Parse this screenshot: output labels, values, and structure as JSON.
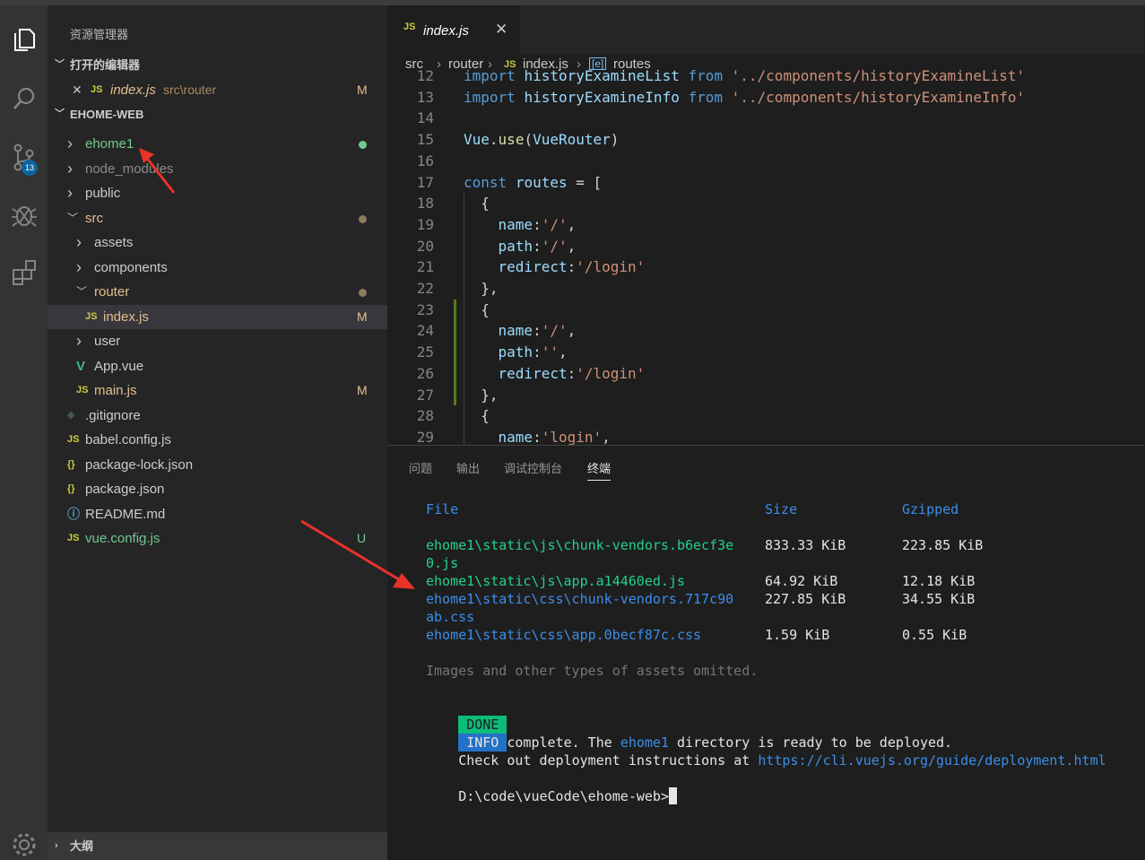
{
  "activity": {
    "icons": [
      "explorer-icon",
      "search-icon",
      "source-control-icon",
      "debug-icon",
      "extensions-icon",
      "settings-gear-icon"
    ],
    "scm_badge": "13"
  },
  "sidebar": {
    "title": "资源管理器",
    "open_editors_header": "打开的编辑器",
    "open_editor": {
      "name": "index.js",
      "path": "src\\router",
      "status": "M",
      "icon": "JS"
    },
    "project_header": "EHOME-WEB",
    "outline_header": "大纲",
    "tree": [
      {
        "label": "ehome1",
        "kind": "folder",
        "dot": "#73c991"
      },
      {
        "label": "node_modules",
        "kind": "folder"
      },
      {
        "label": "public",
        "kind": "folder"
      },
      {
        "label": "src",
        "kind": "folder-open",
        "dot": "#8b7b5e"
      },
      {
        "label": "assets",
        "kind": "folder"
      },
      {
        "label": "components",
        "kind": "folder"
      },
      {
        "label": "router",
        "kind": "folder-open",
        "dot": "#8b7b5e"
      },
      {
        "label": "index.js",
        "kind": "js",
        "status": "M"
      },
      {
        "label": "user",
        "kind": "folder"
      },
      {
        "label": "App.vue",
        "kind": "vue"
      },
      {
        "label": "main.js",
        "kind": "js",
        "status": "M"
      },
      {
        "label": ".gitignore",
        "kind": "git"
      },
      {
        "label": "babel.config.js",
        "kind": "js"
      },
      {
        "label": "package-lock.json",
        "kind": "json"
      },
      {
        "label": "package.json",
        "kind": "json"
      },
      {
        "label": "README.md",
        "kind": "info"
      },
      {
        "label": "vue.config.js",
        "kind": "js",
        "status": "U"
      }
    ],
    "icon_glyphs": {
      "js": "JS",
      "json": "{}",
      "vue": "V",
      "info": "ⓘ",
      "git": "◆"
    }
  },
  "editor": {
    "tab_label": "index.js",
    "tab_icon": "JS",
    "close_glyph": "✕",
    "breadcrumb": [
      "src",
      "router",
      "index.js",
      "routes"
    ],
    "breadcrumb_sep": "›",
    "lines": [
      {
        "n": "12",
        "text": "import historyExamineList from '../components/historyExamineList'"
      },
      {
        "n": "13",
        "text": "import historyExamineInfo from '../components/historyExamineInfo'"
      },
      {
        "n": "14",
        "text": ""
      },
      {
        "n": "15",
        "text": "Vue.use(VueRouter)"
      },
      {
        "n": "16",
        "text": ""
      },
      {
        "n": "17",
        "text": "const routes = ["
      },
      {
        "n": "18",
        "text": "  {"
      },
      {
        "n": "19",
        "text": "    name:'/',"
      },
      {
        "n": "20",
        "text": "    path:'/',"
      },
      {
        "n": "21",
        "text": "    redirect:'/login'"
      },
      {
        "n": "22",
        "text": "  },"
      },
      {
        "n": "23",
        "text": "  {"
      },
      {
        "n": "24",
        "text": "    name:'/',"
      },
      {
        "n": "25",
        "text": "    path:'',"
      },
      {
        "n": "26",
        "text": "    redirect:'/login'"
      },
      {
        "n": "27",
        "text": "  },"
      },
      {
        "n": "28",
        "text": "  {"
      },
      {
        "n": "29",
        "text": "    name:'login',"
      }
    ]
  },
  "panel": {
    "tabs": [
      "问题",
      "输出",
      "调试控制台",
      "终端"
    ],
    "active_tab": "终端",
    "headers": {
      "file": "File",
      "size": "Size",
      "gzipped": "Gzipped"
    },
    "rows": [
      {
        "file1": "ehome1\\static\\js\\chunk-vendors.b6ecf3e",
        "file2": "0.js",
        "size": "833.33 KiB",
        "gz": "223.85 KiB",
        "color": "green"
      },
      {
        "file1": "ehome1\\static\\js\\app.a14460ed.js",
        "file2": "",
        "size": "64.92 KiB",
        "gz": "12.18 KiB",
        "color": "green"
      },
      {
        "file1": "ehome1\\static\\css\\chunk-vendors.717c90",
        "file2": "ab.css",
        "size": "227.85 KiB",
        "gz": "34.55 KiB",
        "color": "blue"
      },
      {
        "file1": "ehome1\\static\\css\\app.0becf87c.css",
        "file2": "",
        "size": "1.59 KiB",
        "gz": "0.55 KiB",
        "color": "blue"
      }
    ],
    "omitted": "Images and other types of assets omitted.",
    "done_tag": "DONE",
    "done_before": "Build complete. The ",
    "done_dir": "ehome1",
    "done_after": " directory is ready to be deployed.",
    "info_tag": "INFO",
    "info_text": "Check out deployment instructions at ",
    "info_link": "https://cli.vuejs.org/guide/deployment.html",
    "prompt": "D:\\code\\vueCode\\ehome-web>"
  },
  "colors": {
    "done": "#0dbc79",
    "info": "#2472c8",
    "annotation": "#e8322a"
  }
}
